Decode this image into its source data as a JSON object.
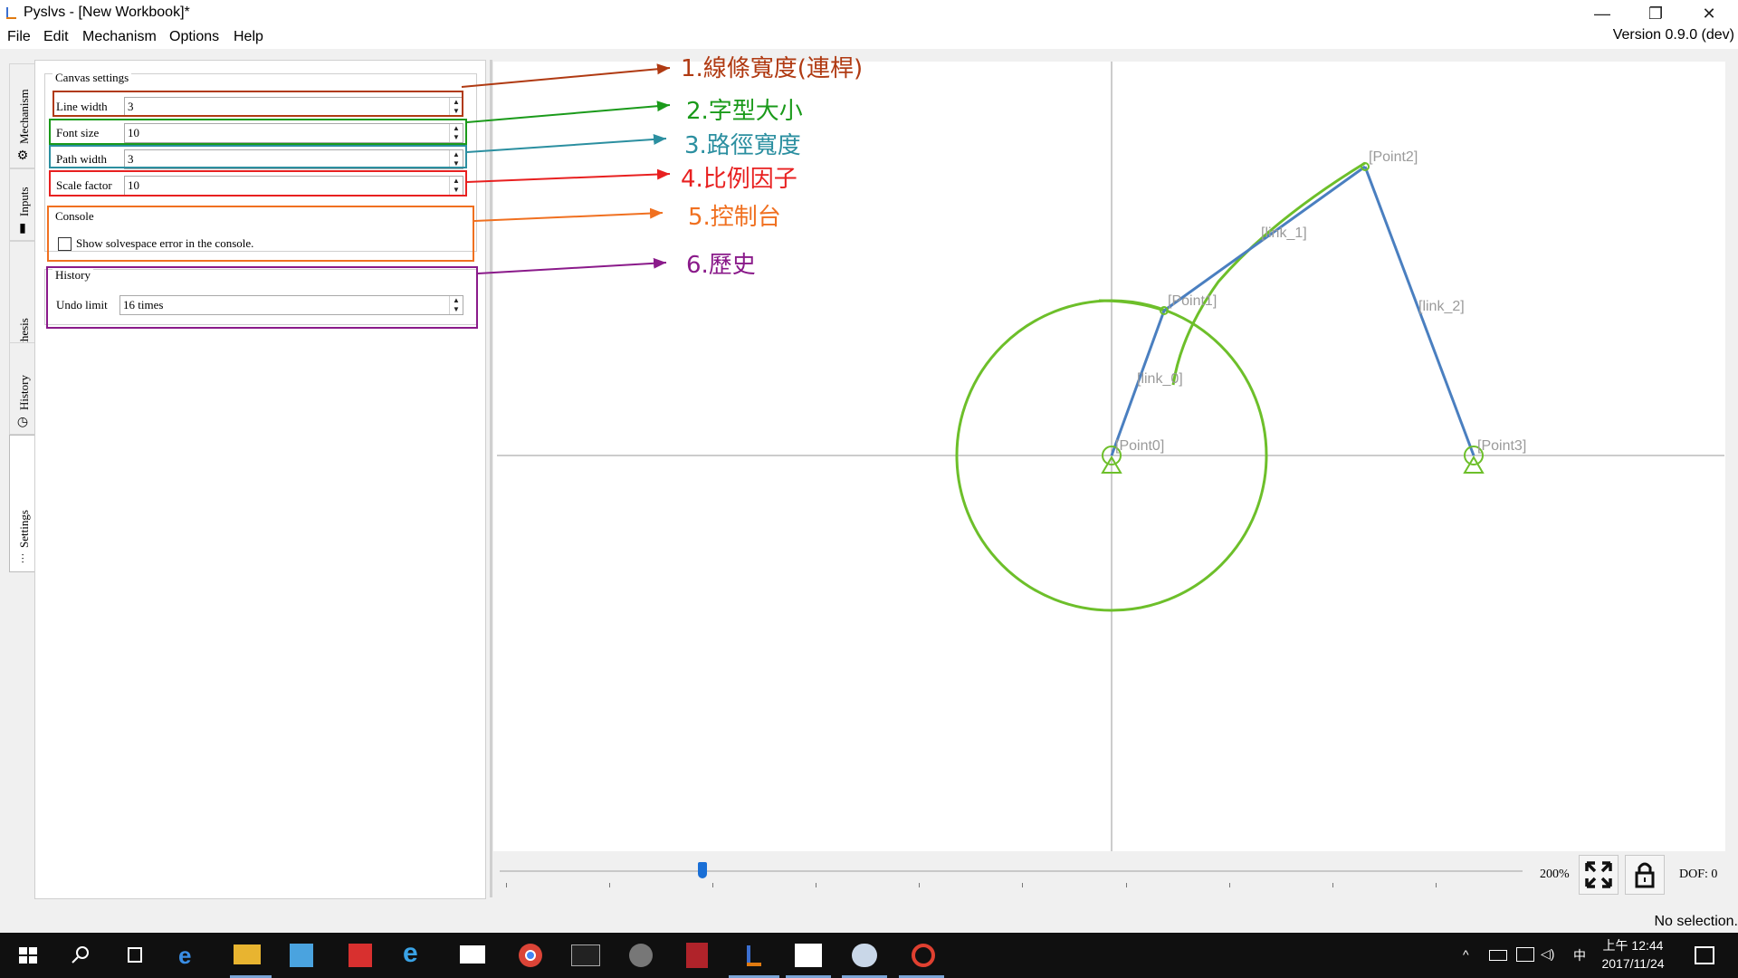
{
  "window": {
    "title": "Pyslvs - [New Workbook]*",
    "version": "Version 0.9.0 (dev)",
    "controls": {
      "minimize": "—",
      "restore": "❐",
      "close": "✕"
    }
  },
  "menu": [
    "File",
    "Edit",
    "Mechanism",
    "Options",
    "Help"
  ],
  "side_tabs": [
    {
      "label": "Mechanism",
      "icon": "gear-icon"
    },
    {
      "label": "Inputs",
      "icon": "inputs-icon"
    },
    {
      "label": "Synthesis",
      "icon": "synthesis-icon"
    },
    {
      "label": "History",
      "icon": "history-icon"
    },
    {
      "label": "Settings",
      "icon": "sliders-icon",
      "active": true
    }
  ],
  "settings": {
    "canvas_group": "Canvas settings",
    "line_width": {
      "label": "Line width",
      "value": "3"
    },
    "font_size": {
      "label": "Font size",
      "value": "10"
    },
    "path_width": {
      "label": "Path width",
      "value": "3"
    },
    "scale_factor": {
      "label": "Scale factor",
      "value": "10"
    },
    "console_group": "Console",
    "console_checkbox": {
      "label": "Show solvespace error in the console.",
      "checked": false
    },
    "history_group": "History",
    "undo_limit": {
      "label": "Undo limit",
      "value": "16 times"
    }
  },
  "annotations": [
    {
      "text": "1.線條寬度(連桿)",
      "color": "#b03a12"
    },
    {
      "text": "2.字型大小",
      "color": "#1a9a1a"
    },
    {
      "text": "3.路徑寬度",
      "color": "#2b8fa0"
    },
    {
      "text": "4.比例因子",
      "color": "#e82020"
    },
    {
      "text": "5.控制台",
      "color": "#f07020"
    },
    {
      "text": "6.歷史",
      "color": "#8a1a8a"
    }
  ],
  "canvas": {
    "points": [
      "[Point0]",
      "[Point1]",
      "[Point2]",
      "[Point3]"
    ],
    "links": [
      "[link_0]",
      "[link_1]",
      "[link_2]"
    ],
    "link_color": "#4a7fc0",
    "path_color": "#6dbf2a"
  },
  "toolbar": {
    "zoom": "200%",
    "dof": "DOF: 0"
  },
  "status": "No selection.",
  "tray": {
    "ime": "上午 12:44",
    "date": "2017/11/24",
    "lang": "中"
  }
}
